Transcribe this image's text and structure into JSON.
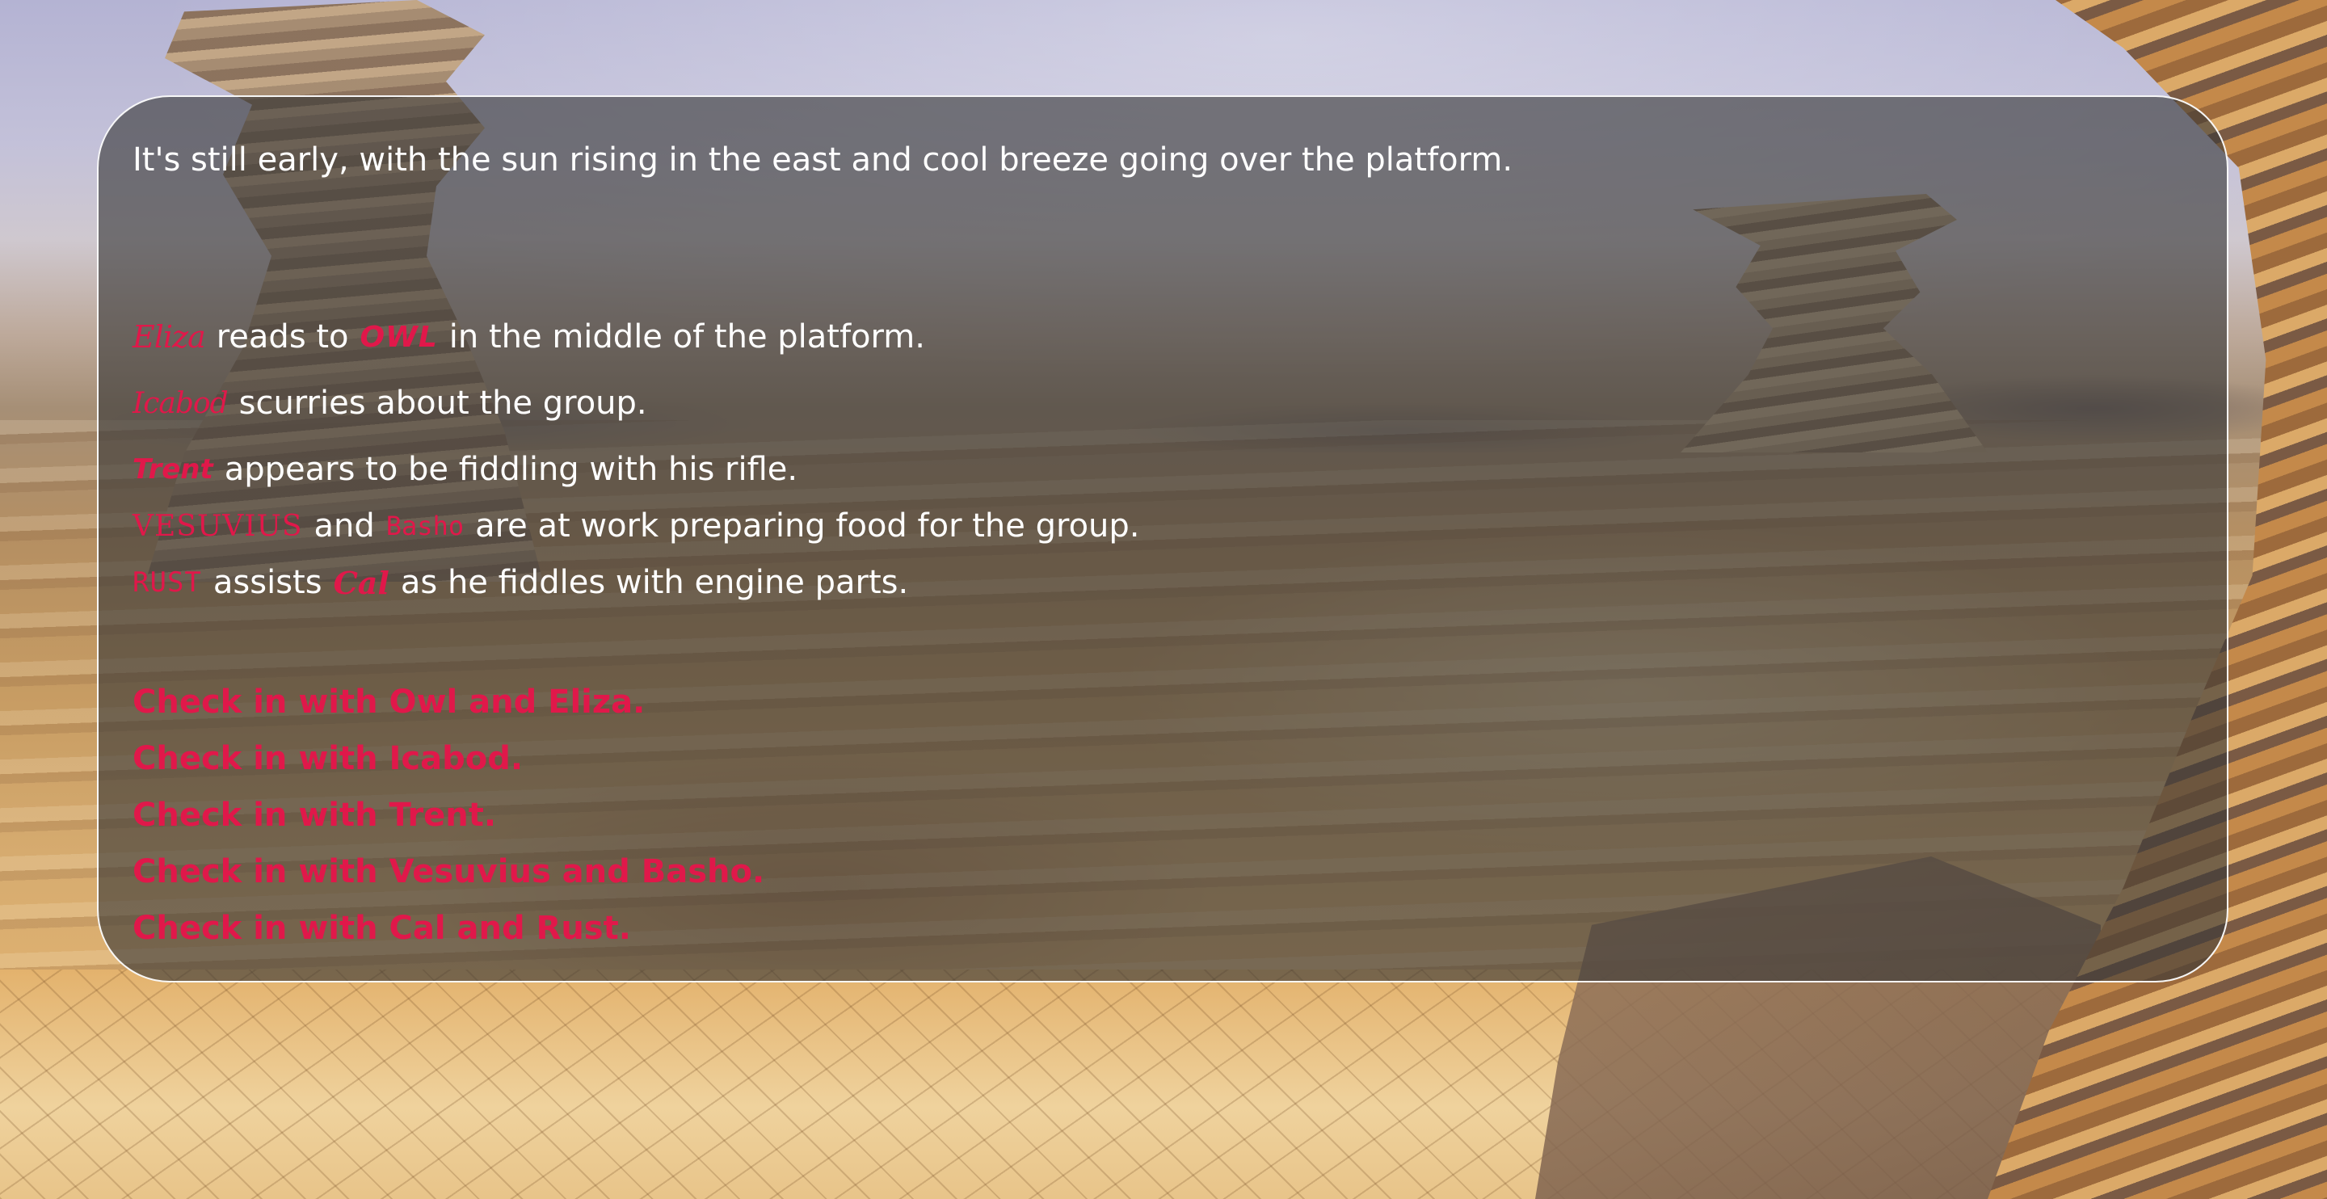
{
  "narration": "It's still early, with the sun rising in the east and cool breeze going over the platform.",
  "scene_lines": [
    {
      "names": [
        "Eliza",
        "Owl"
      ],
      "connector": "reads to",
      "text": "in the middle of the platform."
    },
    {
      "names": [
        "Icabod"
      ],
      "text": "scurries about the group."
    },
    {
      "names": [
        "Trent"
      ],
      "text": "appears to be fiddling with his rifle."
    },
    {
      "names": [
        "Vesuvius",
        "Basho"
      ],
      "connector": "and",
      "text": "are at work preparing food for the group."
    },
    {
      "names": [
        "Rust",
        "Cal"
      ],
      "connector": "assists",
      "text": "as he fiddles with engine parts."
    }
  ],
  "choices": [
    "Check in with Owl and Eliza.",
    "Check in with Icabod.",
    "Check in with Trent.",
    "Check in with Vesuvius and Basho.",
    "Check in with Cal and Rust."
  ],
  "colors": {
    "character_name": "#e0184a",
    "choice_link": "#e0184a",
    "panel_border": "#ffffff",
    "body_text": "#ffffff"
  }
}
